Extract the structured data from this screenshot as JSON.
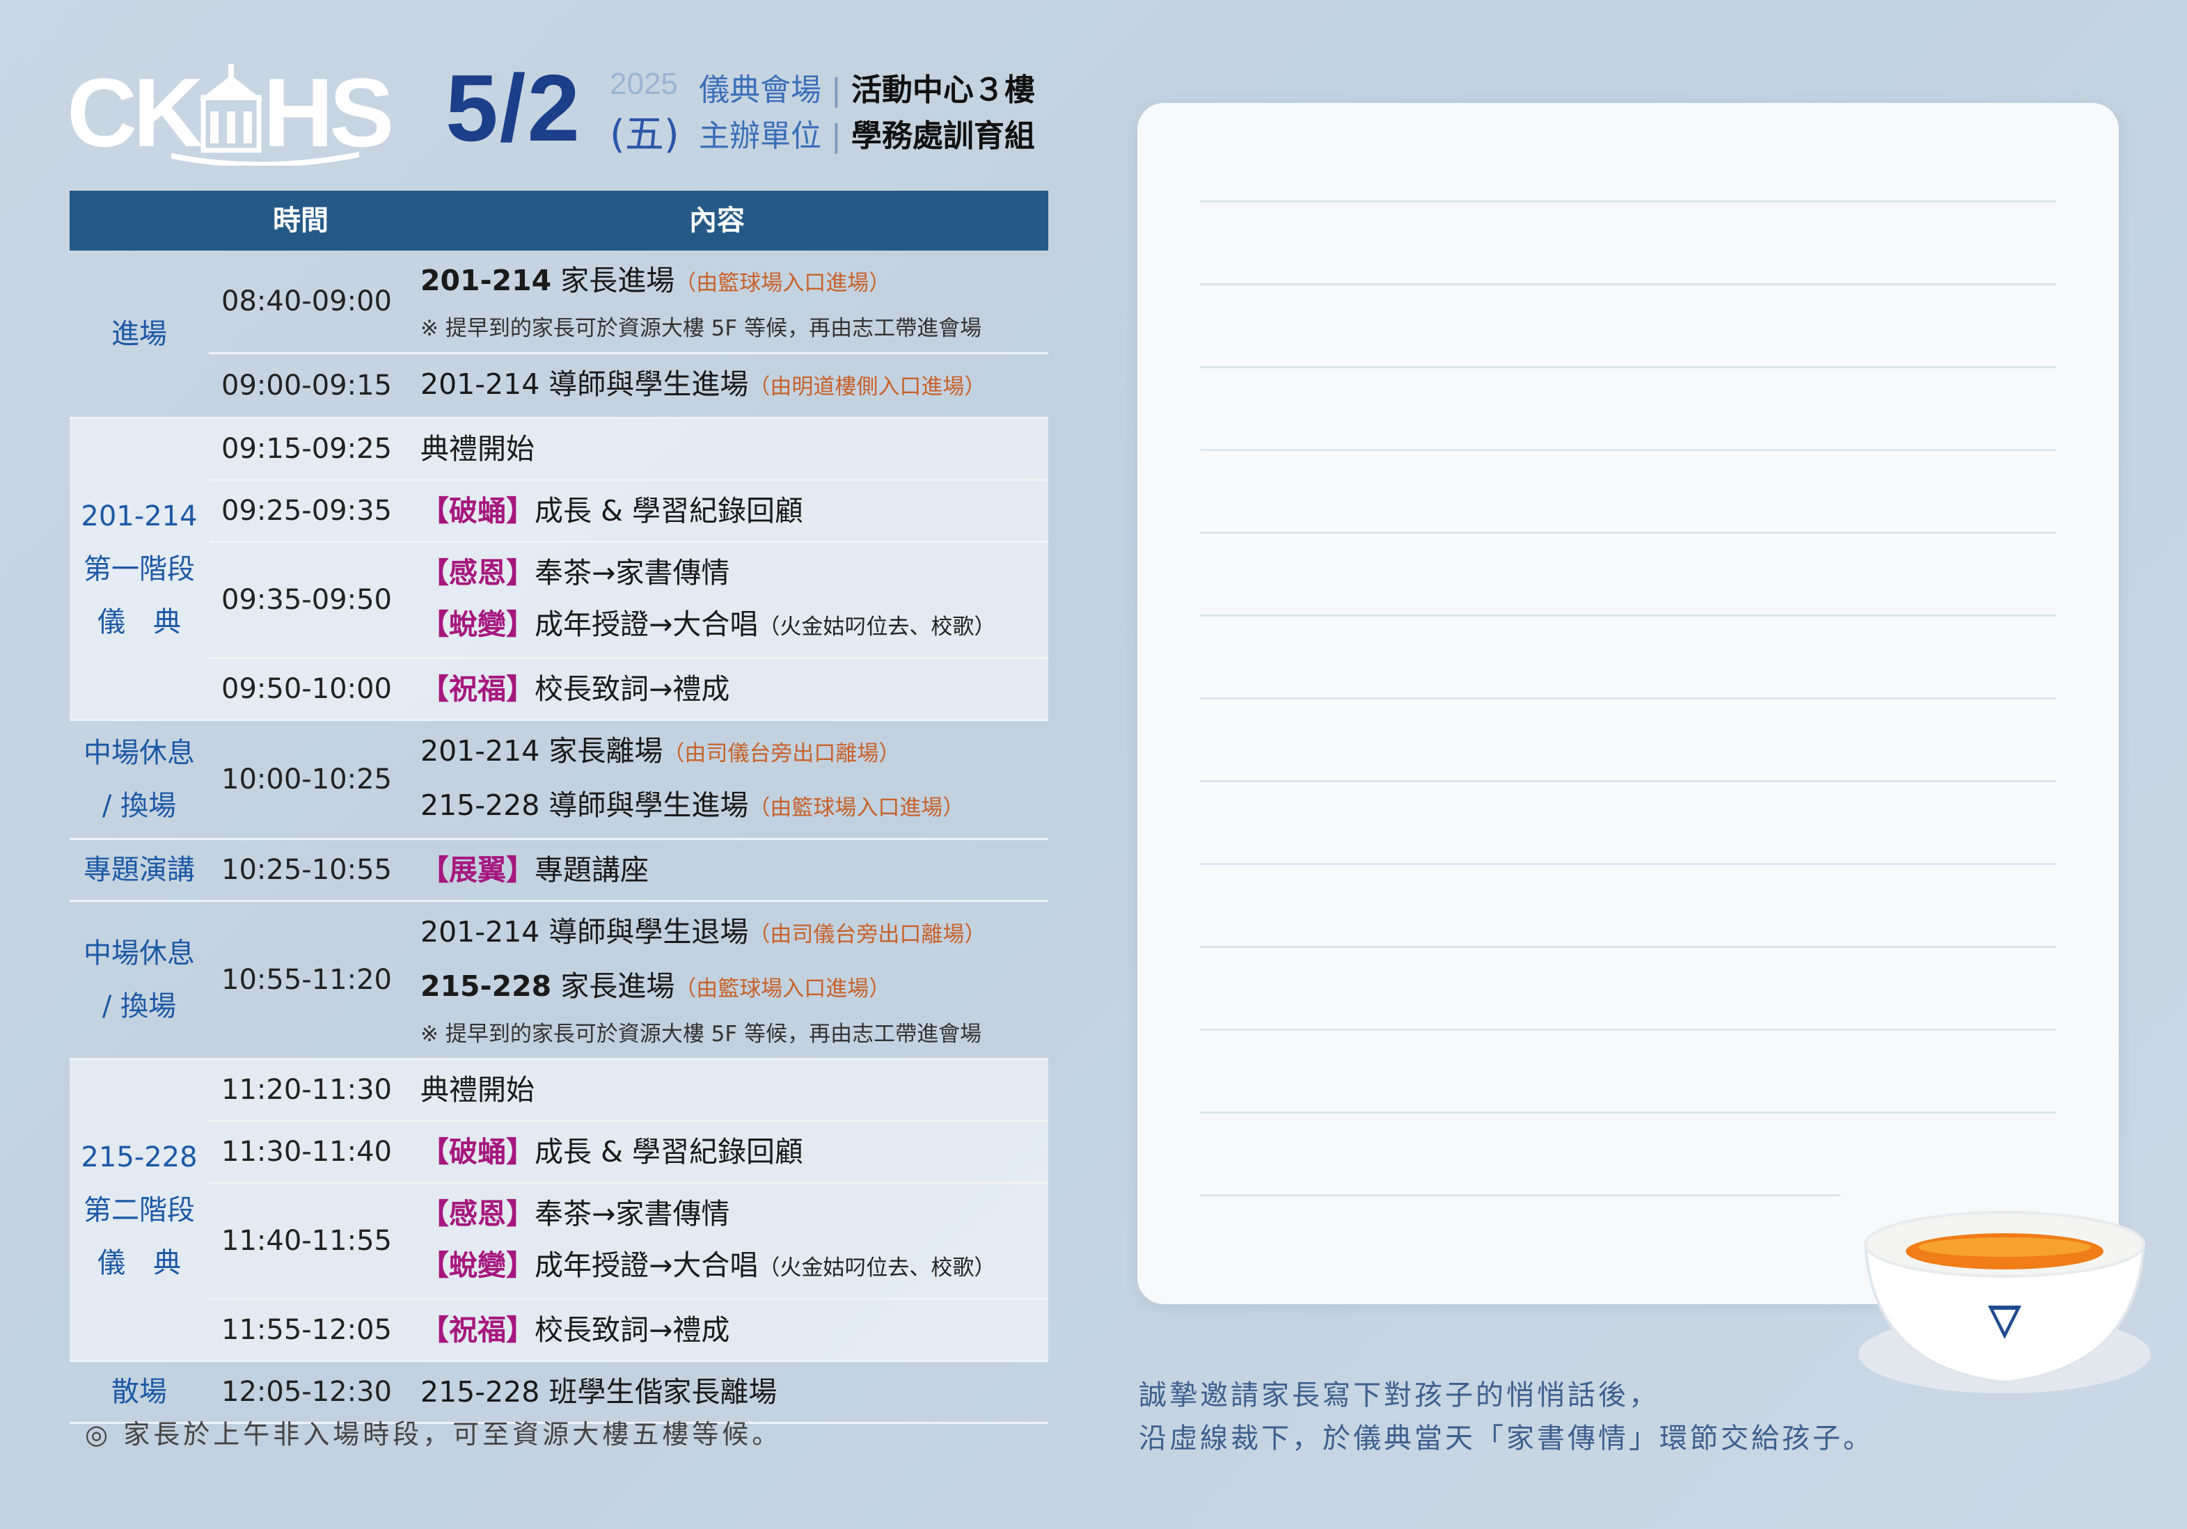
{
  "header": {
    "date": "5/2",
    "year": "2025",
    "weekday": "(五)",
    "venue_label": "儀典會場",
    "venue_value": "活動中心３樓",
    "organizer_label": "主辦單位",
    "organizer_value": "學務處訓育組",
    "separator": "|"
  },
  "table": {
    "col_time": "時間",
    "col_content": "內容"
  },
  "groups": [
    {
      "label": [
        "進場"
      ],
      "rows": [
        {
          "time": "08:40-09:00",
          "lines": [
            [
              {
                "t": "201-214",
                "c": "b"
              },
              {
                "t": " 家長進場"
              },
              {
                "t": "（由籃球場入口進場）",
                "c": "note"
              }
            ],
            [
              {
                "t": "※ 提早到的家長可於資源大樓 5F 等候，再由志工帶進會場",
                "c": "sm"
              }
            ]
          ]
        },
        {
          "time": "09:00-09:15",
          "lines": [
            [
              {
                "t": "201-214 導師與學生進場"
              },
              {
                "t": "（由明道樓側入口進場）",
                "c": "note"
              }
            ]
          ]
        }
      ]
    },
    {
      "label": [
        "201-214",
        "第一階段",
        "儀　典"
      ],
      "alt": true,
      "rows": [
        {
          "time": "09:15-09:25",
          "lines": [
            [
              {
                "t": "典禮開始"
              }
            ]
          ]
        },
        {
          "time": "09:25-09:35",
          "lines": [
            [
              {
                "t": "【破蛹】",
                "c": "tag"
              },
              {
                "t": "成長 & 學習紀錄回顧"
              }
            ]
          ]
        },
        {
          "time": "09:35-09:50",
          "lines": [
            [
              {
                "t": "【感恩】",
                "c": "tag"
              },
              {
                "t": "奉茶→家書傳情"
              }
            ],
            [
              {
                "t": "【蛻變】",
                "c": "tag"
              },
              {
                "t": "成年授證→大合唱"
              },
              {
                "t": "（火金姑叼位去、校歌）",
                "c": "small"
              }
            ]
          ]
        },
        {
          "time": "09:50-10:00",
          "lines": [
            [
              {
                "t": "【祝福】",
                "c": "tag"
              },
              {
                "t": "校長致詞→禮成"
              }
            ]
          ]
        }
      ]
    },
    {
      "label": [
        "中場休息",
        "/ 換場"
      ],
      "rows": [
        {
          "time": "10:00-10:25",
          "lines": [
            [
              {
                "t": "201-214 家長離場"
              },
              {
                "t": "（由司儀台旁出口離場）",
                "c": "note"
              }
            ],
            [
              {
                "t": "215-228 導師與學生進場"
              },
              {
                "t": "（由籃球場入口進場）",
                "c": "note"
              }
            ]
          ]
        }
      ]
    },
    {
      "label": [
        "專題演講"
      ],
      "rows": [
        {
          "time": "10:25-10:55",
          "lines": [
            [
              {
                "t": "【展翼】",
                "c": "tag"
              },
              {
                "t": "專題講座"
              }
            ]
          ]
        }
      ]
    },
    {
      "label": [
        "中場休息",
        "/ 換場"
      ],
      "rows": [
        {
          "time": "10:55-11:20",
          "lines": [
            [
              {
                "t": "201-214 導師與學生退場"
              },
              {
                "t": "（由司儀台旁出口離場）",
                "c": "note"
              }
            ],
            [
              {
                "t": "215-228",
                "c": "b"
              },
              {
                "t": " 家長進場"
              },
              {
                "t": "（由籃球場入口進場）",
                "c": "note"
              }
            ],
            [
              {
                "t": "※ 提早到的家長可於資源大樓 5F 等候，再由志工帶進會場",
                "c": "sm"
              }
            ]
          ]
        }
      ]
    },
    {
      "label": [
        "215-228",
        "第二階段",
        "儀　典"
      ],
      "alt": true,
      "rows": [
        {
          "time": "11:20-11:30",
          "lines": [
            [
              {
                "t": "典禮開始"
              }
            ]
          ]
        },
        {
          "time": "11:30-11:40",
          "lines": [
            [
              {
                "t": "【破蛹】",
                "c": "tag"
              },
              {
                "t": "成長 & 學習紀錄回顧"
              }
            ]
          ]
        },
        {
          "time": "11:40-11:55",
          "lines": [
            [
              {
                "t": "【感恩】",
                "c": "tag"
              },
              {
                "t": "奉茶→家書傳情"
              }
            ],
            [
              {
                "t": "【蛻變】",
                "c": "tag"
              },
              {
                "t": "成年授證→大合唱"
              },
              {
                "t": "（火金姑叼位去、校歌）",
                "c": "small"
              }
            ]
          ]
        },
        {
          "time": "11:55-12:05",
          "lines": [
            [
              {
                "t": "【祝福】",
                "c": "tag"
              },
              {
                "t": "校長致詞→禮成"
              }
            ]
          ]
        }
      ]
    },
    {
      "label": [
        "散場"
      ],
      "rows": [
        {
          "time": "12:05-12:30",
          "lines": [
            [
              {
                "t": "215-228 班學生偕家長離場"
              }
            ]
          ]
        }
      ]
    }
  ],
  "footnote": "◎ 家長於上午非入場時段，可至資源大樓五樓等候。",
  "invite": [
    "誠摯邀請家長寫下對孩子的悄悄話後，",
    "沿虛線裁下，於儀典當天「家書傳情」環節交給孩子。"
  ],
  "logo": {
    "text": "CKHS",
    "icon": "school-building-logo-icon"
  },
  "colors": {
    "header_bar": "#255987",
    "accent_blue": "#1c59a5",
    "tag_purple": "#a6177e",
    "note_orange": "#c7622a"
  },
  "decor": {
    "bowl": "tea-bowl-icon"
  }
}
